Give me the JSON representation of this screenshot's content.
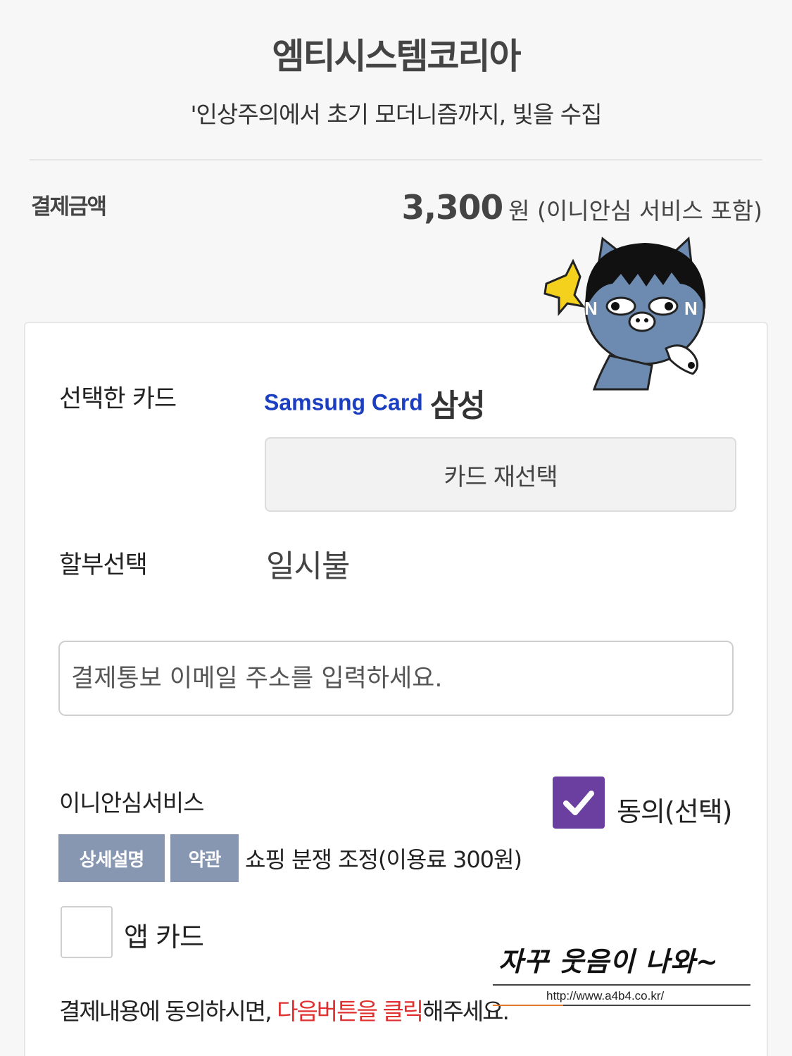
{
  "header": {
    "merchant_name": "엠티시스템코리아",
    "product_name": "'인상주의에서 초기 모더니즘까지, 빛을 수집"
  },
  "payment": {
    "amount_label": "결제금액",
    "amount_value": "3,300",
    "amount_unit": "원 (이니안심 서비스 포함)"
  },
  "card": {
    "selected_label": "선택한 카드",
    "brand_logo_text": "Samsung Card",
    "brand_name": "삼성",
    "reselect_label": "카드 재선택"
  },
  "installment": {
    "label": "할부선택",
    "value": "일시불"
  },
  "email": {
    "placeholder": "결제통보 이메일 주소를 입력하세요."
  },
  "service": {
    "title": "이니안심서비스",
    "agree_label": "동의(선택)",
    "agree_checked": true,
    "detail_button": "상세설명",
    "terms_button": "약관",
    "description": "쇼핑 분쟁 조정(이용료 300원)"
  },
  "app_card": {
    "label": "앱 카드",
    "checked": false
  },
  "notice": {
    "prefix": "결제내용에 동의하시면, ",
    "highlight": "다음버튼을 클릭",
    "suffix": "해주세요."
  },
  "watermark": {
    "text": "자꾸 웃음이 나와~",
    "url": "http://www.a4b4.co.kr/"
  },
  "colors": {
    "card_brand_blue": "#1c3fc2",
    "checkbox_purple": "#6a3fa0",
    "tag_button_gray_blue": "#8797b2",
    "highlight_red": "#e02f2f"
  },
  "icons": {
    "checkmark": "check-icon",
    "sticker": "cat-character-sticker-icon"
  }
}
